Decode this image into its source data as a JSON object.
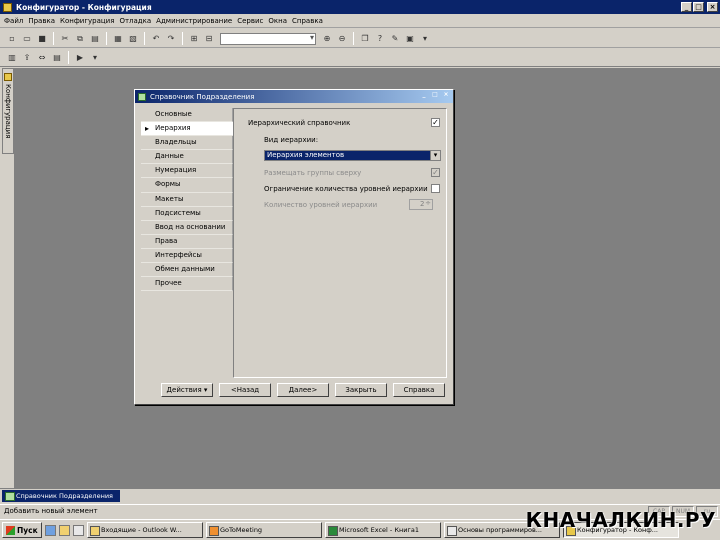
{
  "app": {
    "title": "Конфигуратор - Конфигурация",
    "window_buttons": [
      "_",
      "□",
      "×"
    ]
  },
  "menu": [
    "Файл",
    "Правка",
    "Конфигурация",
    "Отладка",
    "Администрирование",
    "Сервис",
    "Окна",
    "Справка"
  ],
  "toolbar": {
    "search_value": ""
  },
  "sidetab": {
    "label": "Конфигурация"
  },
  "dialog": {
    "title": "Справочник Подразделения",
    "nav": [
      "Основные",
      "Иерархия",
      "Владельцы",
      "Данные",
      "Нумерация",
      "Формы",
      "Макеты",
      "Подсистемы",
      "Ввод на основании",
      "Права",
      "Интерфейсы",
      "Обмен данными",
      "Прочее"
    ],
    "selected_nav": "Иерархия",
    "hierarchy": {
      "hierarchical_label": "Иерархический справочник",
      "hierarchical_checked": "✓",
      "type_label": "Вид иерархии:",
      "type_value": "Иерархия элементов",
      "groups_top_label": "Размещать группы сверху",
      "groups_top_checked": "✓",
      "limit_levels_label": "Ограничение количества уровней иерархии",
      "limit_levels_checked": "",
      "levels_count_label": "Количество уровней иерархии",
      "levels_count_value": "2"
    },
    "buttons": {
      "actions": "Действия ▾",
      "back": "<Назад",
      "next": "Далее>",
      "close": "Закрыть",
      "help": "Справка"
    }
  },
  "bottom_tab": "Справочник Подразделения",
  "status": {
    "text": "Добавить новый элемент",
    "indicators": [
      "CAP",
      "NUM",
      "ru"
    ]
  },
  "taskbar": {
    "start": "Пуск",
    "tasks": [
      {
        "label": "Входящие - Outlook W...",
        "color": "#f0d070"
      },
      {
        "label": "GoToMeeting",
        "color": "#f09030"
      },
      {
        "label": "Microsoft Excel - Книга1",
        "color": "#2a8a3a"
      },
      {
        "label": "Основы программиров...",
        "color": "#e8e8e8"
      },
      {
        "label": "Конфигуратор - Конф...",
        "color": "#e8c84a"
      }
    ]
  },
  "watermark": "КНАЧАЛКИН.РУ"
}
